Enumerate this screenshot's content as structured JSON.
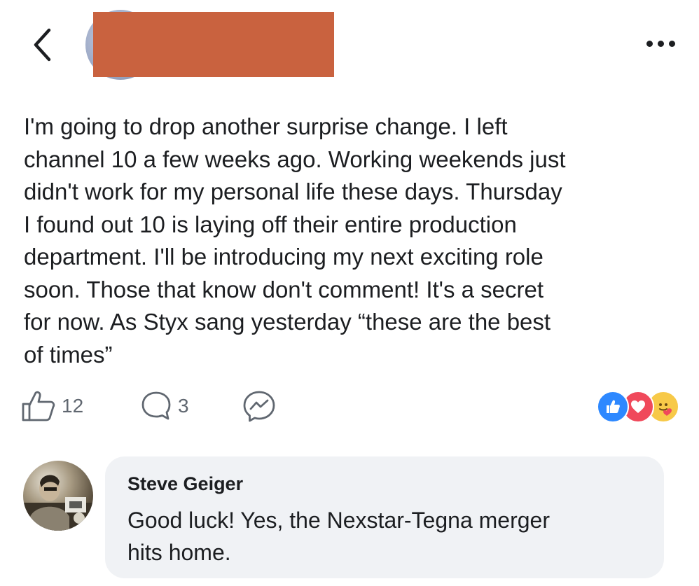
{
  "header": {
    "back_icon": "chevron-left-icon",
    "more_icon": "more-horizontal-icon"
  },
  "post": {
    "lines": [
      "I'm going to drop another surprise change.  I left",
      "channel 10 a few weeks ago. Working weekends just",
      "didn't work for my personal life these days.  Thursday",
      "I found out 10 is laying off their entire production",
      "department. I'll be introducing my next exciting role",
      "soon. Those that know don't comment! It's a secret",
      "for now.  As Styx sang yesterday “these are the best",
      "of times”"
    ],
    "like_count": "12",
    "comment_count": "3",
    "reactions": [
      "like-icon",
      "love-icon",
      "care-icon"
    ],
    "colors": {
      "like": "#2d88ff",
      "love": "#f0495b",
      "care": "#f7c948"
    }
  },
  "comment": {
    "author": "Steve Geiger",
    "text_lines": [
      "Good luck! Yes, the Nexstar-Tegna merger",
      "hits home."
    ]
  }
}
